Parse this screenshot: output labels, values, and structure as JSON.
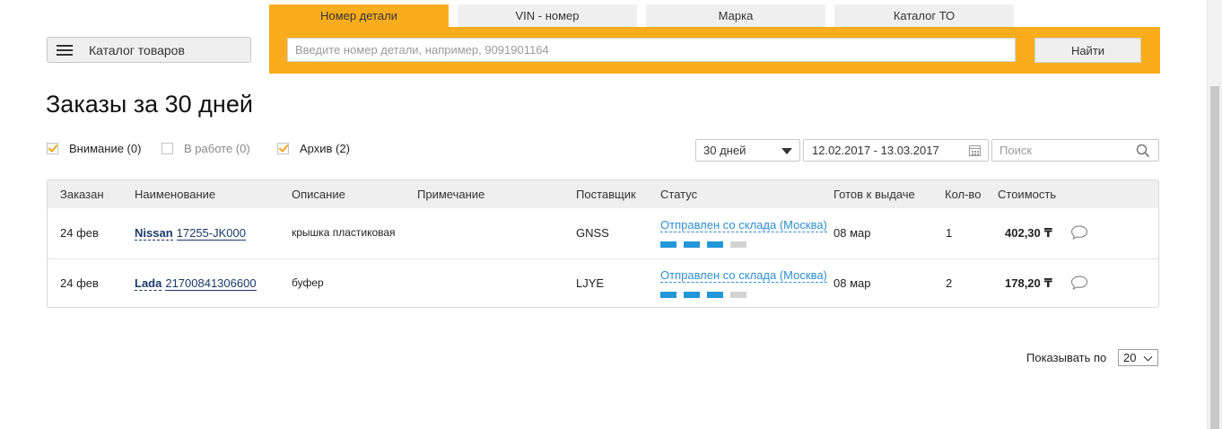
{
  "catalog_button": {
    "label": "Каталог товаров"
  },
  "search": {
    "tabs": [
      {
        "label": "Номер детали",
        "active": true
      },
      {
        "label": "VIN - номер",
        "active": false
      },
      {
        "label": "Марка",
        "active": false
      },
      {
        "label": "Каталог ТО",
        "active": false
      }
    ],
    "placeholder": "Введите номер детали, например, 9091901164",
    "value": "",
    "find_label": "Найти"
  },
  "page": {
    "title": "Заказы за 30 дней"
  },
  "filters": [
    {
      "label": "Внимание (0)",
      "checked": true
    },
    {
      "label": "В работе (0)",
      "checked": false
    },
    {
      "label": "Архив (2)",
      "checked": true
    }
  ],
  "period": {
    "selected": "30 дней"
  },
  "date_range": {
    "value": "12.02.2017 - 13.03.2017"
  },
  "table_search": {
    "placeholder": "Поиск",
    "value": ""
  },
  "table": {
    "columns": [
      "Заказан",
      "Наименование",
      "Описание",
      "Примечание",
      "Поставщик",
      "Статус",
      "Готов к выдаче",
      "Кол-во",
      "Стоимость"
    ],
    "rows": [
      {
        "ordered": "24 фев",
        "brand": "Nissan",
        "part_number": "17255-JK000",
        "description": "крышка пластиковая",
        "note": "",
        "supplier": "GNSS",
        "status": "Отправлен со склада (Москва)",
        "status_progress": "3/4",
        "ready": "08 мар",
        "qty": "1",
        "price": "402,30",
        "currency": "₸"
      },
      {
        "ordered": "24 фев",
        "brand": "Lada",
        "part_number": "21700841306600",
        "description": "буфер",
        "note": "",
        "supplier": "LJYE",
        "status": "Отправлен со склада (Москва)",
        "status_progress": "3/4",
        "ready": "08 мар",
        "qty": "2",
        "price": "178,20",
        "currency": "₸"
      }
    ]
  },
  "pagination": {
    "label": "Показывать по",
    "per_page": "20"
  },
  "colors": {
    "accent": "#f9ad1c",
    "status_link": "#2f8fd1",
    "progress_on": "#2196d8",
    "link": "#1a3a6b"
  }
}
